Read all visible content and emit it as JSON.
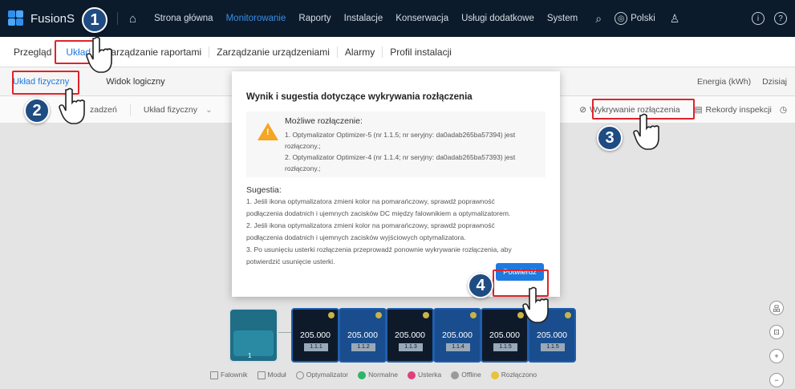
{
  "app": {
    "name": "FusionS"
  },
  "topnav": {
    "items": [
      "Strona główna",
      "Monitorowanie",
      "Raporty",
      "Instalacje",
      "Konserwacja",
      "Usługi dodatkowe",
      "System"
    ],
    "language": "Polski"
  },
  "tabs": [
    "Przegląd",
    "Układ",
    "Zarządzanie raportami",
    "Zarządzanie urządzeniami",
    "Alarmy",
    "Profil instalacji"
  ],
  "subtabs": [
    "Układ fizyczny",
    "Widok logiczny"
  ],
  "subbar_right": {
    "energy": "Energia (kWh)",
    "period": "Dzisiaj"
  },
  "toolbar": {
    "left_1": "zadzeń",
    "left_2": "Układ fizyczny",
    "detect": "Wykrywanie rozłączenia",
    "records": "Rekordy inspekcji"
  },
  "modal": {
    "title": "Wynik i sugestia dotyczące wykrywania rozłączenia",
    "possible_head": "Możliwe rozłączenie:",
    "possible_lines": [
      "1. Optymalizator Optimizer-5 (nr 1.1.5; nr seryjny: da0adab265ba57394) jest",
      "rozłączony.;",
      "2. Optymalizator Optimizer-4 (nr 1.1.4; nr seryjny: da0adab265ba57393) jest",
      "rozłączony.;"
    ],
    "suggestion_head": "Sugestia:",
    "suggestion_lines": [
      "1. Jeśli ikona optymalizatora zmieni kolor na pomarańczowy, sprawdź poprawność",
      "podłączenia dodatnich i ujemnych zacisków DC między falownikiem a optymalizatorem.",
      "2. Jeśli ikona optymalizatora zmieni kolor na pomarańczowy, sprawdź poprawność",
      "podłączenia dodatnich i ujemnych zacisków wyjściowych optymalizatora.",
      "3. Po usunięciu usterki rozłączenia przeprowadź ponownie wykrywanie rozłączenia, aby",
      "potwierdzić usunięcie usterki."
    ],
    "confirm": "Potwierdź"
  },
  "devices": {
    "inverter_num": "1",
    "modules": [
      {
        "value": "205.000",
        "tag": "1.1.1"
      },
      {
        "value": "205.000",
        "tag": "1.1.2"
      },
      {
        "value": "205.000",
        "tag": "1.1.3"
      },
      {
        "value": "205.000",
        "tag": "1.1.4"
      },
      {
        "value": "205.000",
        "tag": "1.1.5"
      },
      {
        "value": "205.000",
        "tag": "1.1.5"
      }
    ]
  },
  "legend": [
    "Falownik",
    "Moduł",
    "Optymalizator",
    "Normalne",
    "Usterka",
    "Offline",
    "Rozłączono"
  ],
  "badges": [
    "1",
    "2",
    "3",
    "4"
  ],
  "colors": {
    "accent": "#1f7ae0",
    "highlight": "#e0242b",
    "navbg": "#0c1b2b",
    "badge": "#1f4c82"
  }
}
